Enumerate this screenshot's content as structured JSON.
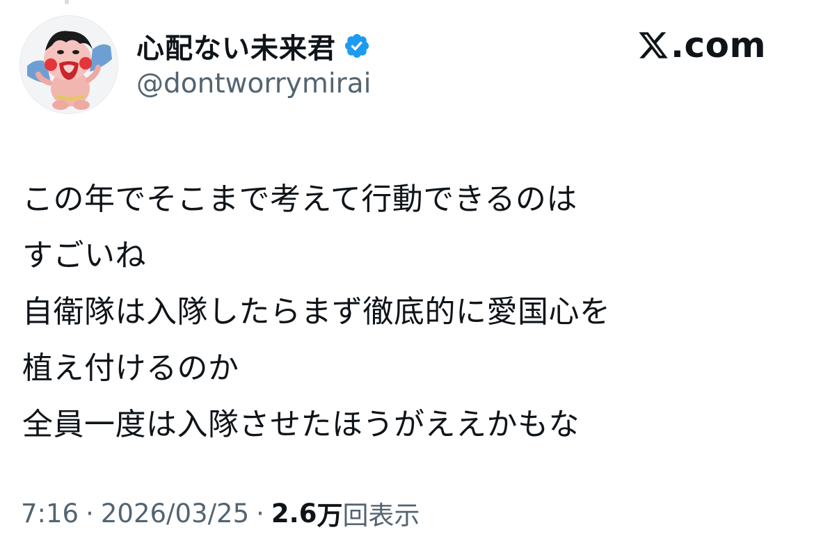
{
  "user": {
    "display_name": "心配ない未来君",
    "handle": "@dontworrymirai",
    "verified": true
  },
  "brand": {
    "text": ".com"
  },
  "tweet": {
    "lines": [
      "この年でそこまで考えて行動できるのは",
      "すごいね",
      "自衛隊は入隊したらまず徹底的に愛国心を",
      "植え付けるのか",
      "全員一度は入隊させたほうがええかもな"
    ]
  },
  "meta": {
    "time": "7:16",
    "separator": "·",
    "date": "2026/03/25",
    "views_count": "2.6",
    "views_unit": "万",
    "views_label": "回表示"
  },
  "colors": {
    "text_primary": "#0f1419",
    "text_secondary": "#536471",
    "verified_blue": "#1d9bf0"
  },
  "icons": {
    "verified": "verified-badge-icon",
    "brand": "x-logo-icon"
  }
}
